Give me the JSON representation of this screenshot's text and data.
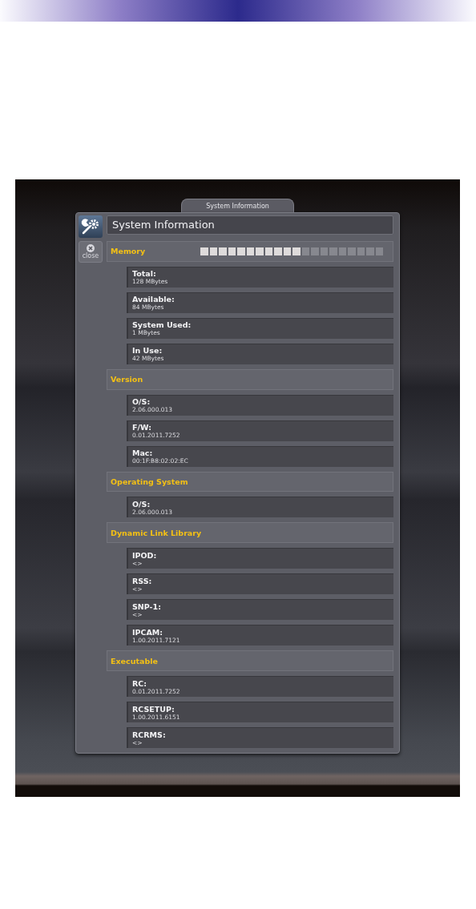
{
  "window": {
    "tab_title": "System Information",
    "title": "System Information"
  },
  "close_button": {
    "label": "close"
  },
  "sections": [
    {
      "title": "Memory",
      "meter": {
        "level": 0.55
      },
      "items": [
        {
          "label": "Total:",
          "value": "128 MBytes"
        },
        {
          "label": "Available:",
          "value": "84 MBytes"
        },
        {
          "label": "System Used:",
          "value": "1 MBytes"
        },
        {
          "label": "In Use:",
          "value": "42 MBytes"
        }
      ]
    },
    {
      "title": "Version",
      "items": [
        {
          "label": "O/S:",
          "value": "2.06.000.013"
        },
        {
          "label": "F/W:",
          "value": "0.01.2011.7252"
        },
        {
          "label": "Mac:",
          "value": "00:1F:B8:02:02:EC"
        }
      ]
    },
    {
      "title": "Operating System",
      "items": [
        {
          "label": "O/S:",
          "value": "2.06.000.013"
        }
      ]
    },
    {
      "title": "Dynamic Link Library",
      "items": [
        {
          "label": "IPOD:",
          "value": "<>"
        },
        {
          "label": "RSS:",
          "value": "<>"
        },
        {
          "label": "SNP-1:",
          "value": "<>"
        },
        {
          "label": "IPCAM:",
          "value": "1.00.2011.7121"
        }
      ]
    },
    {
      "title": "Executable",
      "items": [
        {
          "label": "RC:",
          "value": "0.01.2011.7252"
        },
        {
          "label": "RCSETUP:",
          "value": "1.00.2011.6151"
        },
        {
          "label": "RCRMS:",
          "value": "<>"
        }
      ]
    }
  ]
}
